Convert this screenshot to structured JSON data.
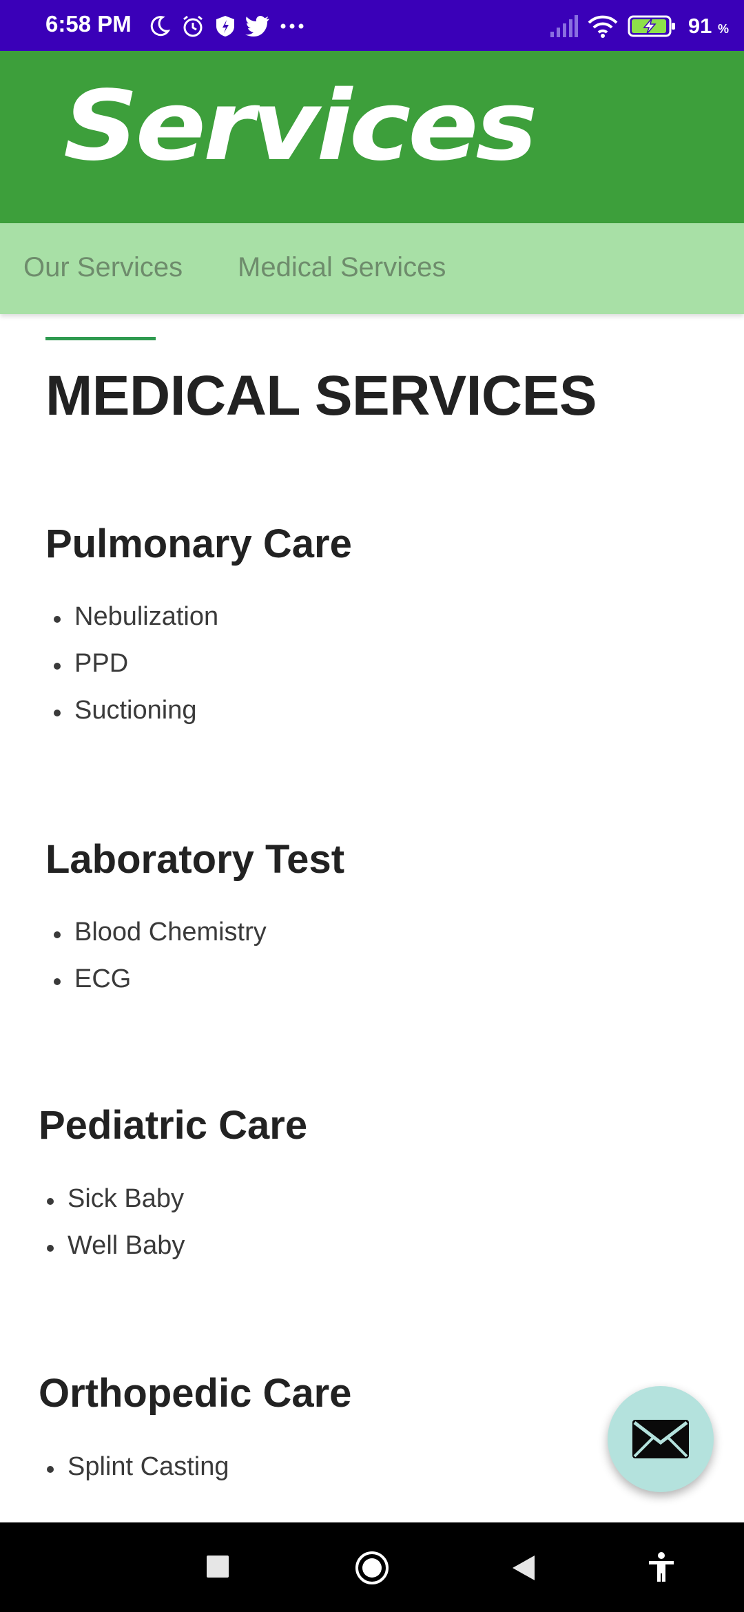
{
  "status_bar": {
    "time": "6:58 PM",
    "icons_left": [
      "moon-icon",
      "alarm-icon",
      "shield-icon",
      "twitter-icon",
      "more-icon"
    ],
    "icons_right": [
      "signal-icon",
      "wifi-icon",
      "battery-icon"
    ],
    "battery_percent": "91",
    "battery_unit": "%"
  },
  "header": {
    "title": "Services",
    "background_color": "#3d9f3b"
  },
  "tabs": [
    {
      "label": "Our Services"
    },
    {
      "label": "Medical Services"
    }
  ],
  "main": {
    "title": "MEDICAL SERVICES",
    "accent_color": "#2e9a4f",
    "sections": [
      {
        "title": "Pulmonary Care",
        "items": [
          "Nebulization",
          "PPD",
          "Suctioning"
        ]
      },
      {
        "title": "Laboratory Test",
        "items": [
          "Blood Chemistry",
          "ECG"
        ]
      },
      {
        "title": "Pediatric Care",
        "items": [
          "Sick Baby",
          "Well Baby"
        ]
      },
      {
        "title": "Orthopedic Care",
        "items": [
          "Splint Casting"
        ]
      }
    ]
  },
  "fab": {
    "icon": "mail-icon",
    "color": "#b4e2dd"
  },
  "nav": {
    "icons": [
      "recents-icon",
      "home-icon",
      "back-icon",
      "accessibility-icon"
    ]
  }
}
